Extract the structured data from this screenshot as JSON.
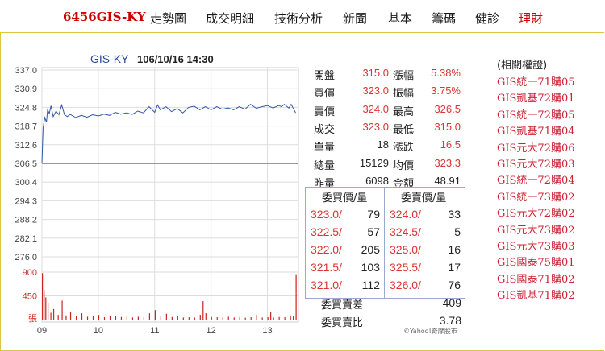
{
  "nav": {
    "stock": "6456GIS-KY",
    "items": [
      "走勢圖",
      "成交明細",
      "技術分析",
      "新聞",
      "基本",
      "籌碼",
      "健診",
      "理財"
    ]
  },
  "chart_header": {
    "symbol": "GIS-KY",
    "datetime": "106/10/16 14:30"
  },
  "chart_data": {
    "type": "line",
    "y_ticks": [
      "337.0",
      "330.9",
      "324.8",
      "318.7",
      "312.6",
      "306.5",
      "300.4",
      "294.3",
      "288.2",
      "282.1",
      "276.0"
    ],
    "ylim": [
      276.0,
      337.0
    ],
    "reference_price": 306.5,
    "x_ticks": [
      "09",
      "10",
      "11",
      "12",
      "13"
    ],
    "volume_ticks": [
      "900",
      "450",
      "張"
    ],
    "volume_max": 900,
    "price_series": [
      [
        9.0,
        306.5
      ],
      [
        9.02,
        318.0
      ],
      [
        9.05,
        321.5
      ],
      [
        9.08,
        320.0
      ],
      [
        9.1,
        324.0
      ],
      [
        9.13,
        322.8
      ],
      [
        9.16,
        325.3
      ],
      [
        9.2,
        321.8
      ],
      [
        9.25,
        323.6
      ],
      [
        9.3,
        322.4
      ],
      [
        9.35,
        325.6
      ],
      [
        9.4,
        322.4
      ],
      [
        9.45,
        321.8
      ],
      [
        9.5,
        322.5
      ],
      [
        9.6,
        321.5
      ],
      [
        9.7,
        322.2
      ],
      [
        9.8,
        321.6
      ],
      [
        9.9,
        322.4
      ],
      [
        10.0,
        322.0
      ],
      [
        10.1,
        322.6
      ],
      [
        10.2,
        322.2
      ],
      [
        10.3,
        323.2
      ],
      [
        10.4,
        322.6
      ],
      [
        10.5,
        323.0
      ],
      [
        10.6,
        322.5
      ],
      [
        10.7,
        323.6
      ],
      [
        10.8,
        323.0
      ],
      [
        10.9,
        325.0
      ],
      [
        11.0,
        323.2
      ],
      [
        11.05,
        325.6
      ],
      [
        11.1,
        324.0
      ],
      [
        11.2,
        325.0
      ],
      [
        11.3,
        323.4
      ],
      [
        11.4,
        324.4
      ],
      [
        11.5,
        323.0
      ],
      [
        11.6,
        324.8
      ],
      [
        11.7,
        325.2
      ],
      [
        11.8,
        324.0
      ],
      [
        11.9,
        325.0
      ],
      [
        12.0,
        324.0
      ],
      [
        12.1,
        325.0
      ],
      [
        12.2,
        324.2
      ],
      [
        12.3,
        324.6
      ],
      [
        12.4,
        324.0
      ],
      [
        12.5,
        325.0
      ],
      [
        12.6,
        324.2
      ],
      [
        12.7,
        325.8
      ],
      [
        12.8,
        324.5
      ],
      [
        12.9,
        325.0
      ],
      [
        13.0,
        325.4
      ],
      [
        13.1,
        324.6
      ],
      [
        13.2,
        325.4
      ],
      [
        13.25,
        325.0
      ],
      [
        13.3,
        325.8
      ],
      [
        13.38,
        324.6
      ],
      [
        13.42,
        325.8
      ],
      [
        13.5,
        323.0
      ]
    ],
    "volume_series": [
      [
        9.0,
        880
      ],
      [
        9.03,
        560
      ],
      [
        9.06,
        420
      ],
      [
        9.1,
        320
      ],
      [
        9.15,
        130
      ],
      [
        9.2,
        200
      ],
      [
        9.28,
        90
      ],
      [
        9.35,
        360
      ],
      [
        9.42,
        80
      ],
      [
        9.5,
        150
      ],
      [
        9.6,
        60
      ],
      [
        9.7,
        120
      ],
      [
        9.8,
        55
      ],
      [
        9.9,
        70
      ],
      [
        10.0,
        90
      ],
      [
        10.1,
        45
      ],
      [
        10.2,
        60
      ],
      [
        10.3,
        70
      ],
      [
        10.4,
        50
      ],
      [
        10.5,
        65
      ],
      [
        10.6,
        40
      ],
      [
        10.7,
        55
      ],
      [
        10.8,
        45
      ],
      [
        10.9,
        120
      ],
      [
        11.0,
        180
      ],
      [
        11.1,
        60
      ],
      [
        11.2,
        110
      ],
      [
        11.3,
        50
      ],
      [
        11.4,
        70
      ],
      [
        11.5,
        40
      ],
      [
        11.6,
        45
      ],
      [
        11.7,
        40
      ],
      [
        11.8,
        90
      ],
      [
        11.85,
        350
      ],
      [
        11.9,
        120
      ],
      [
        12.0,
        50
      ],
      [
        12.1,
        45
      ],
      [
        12.2,
        40
      ],
      [
        12.3,
        55
      ],
      [
        12.4,
        40
      ],
      [
        12.5,
        50
      ],
      [
        12.6,
        35
      ],
      [
        12.7,
        45
      ],
      [
        12.8,
        90
      ],
      [
        12.9,
        40
      ],
      [
        13.0,
        45
      ],
      [
        13.05,
        140
      ],
      [
        13.1,
        40
      ],
      [
        13.2,
        50
      ],
      [
        13.3,
        45
      ],
      [
        13.4,
        80
      ],
      [
        13.45,
        60
      ],
      [
        13.5,
        860
      ]
    ],
    "line_color": "#3355aa",
    "volume_color": "#cc2222",
    "reference_color": "#999999"
  },
  "quote": {
    "rows": [
      {
        "l1": "開盤",
        "v1": "315.0",
        "c1": "red",
        "l2": "漲幅",
        "v2": "5.38%",
        "c2": "red"
      },
      {
        "l1": "買價",
        "v1": "323.0",
        "c1": "red",
        "l2": "振幅",
        "v2": "3.75%",
        "c2": "red"
      },
      {
        "l1": "賣價",
        "v1": "324.0",
        "c1": "red",
        "l2": "最高",
        "v2": "326.5",
        "c2": "red"
      },
      {
        "l1": "成交",
        "v1": "323.0",
        "c1": "red",
        "l2": "最低",
        "v2": "315.0",
        "c2": "red"
      },
      {
        "l1": "單量",
        "v1": "18",
        "c1": "black",
        "l2": "漲跌",
        "v2": "16.5",
        "c2": "red"
      },
      {
        "l1": "總量",
        "v1": "15129",
        "c1": "black",
        "l2": "均價",
        "v2": "323.3",
        "c2": "red"
      },
      {
        "l1": "昨量",
        "v1": "6098",
        "c1": "black",
        "l2": "金額",
        "v2": "48.91",
        "c2": "black"
      }
    ]
  },
  "order_book": {
    "bid_header": "委買價/量",
    "ask_header": "委賣價/量",
    "bids": [
      {
        "price": "323.0/",
        "qty": "79"
      },
      {
        "price": "322.5/",
        "qty": "57"
      },
      {
        "price": "322.0/",
        "qty": "205"
      },
      {
        "price": "321.5/",
        "qty": "103"
      },
      {
        "price": "321.0/",
        "qty": "112"
      }
    ],
    "asks": [
      {
        "price": "324.0/",
        "qty": "33"
      },
      {
        "price": "324.5/",
        "qty": "5"
      },
      {
        "price": "325.0/",
        "qty": "16"
      },
      {
        "price": "325.5/",
        "qty": "17"
      },
      {
        "price": "326.0/",
        "qty": "76"
      }
    ],
    "diff_label": "委買賣差",
    "diff_value": "409",
    "ratio_label": "委買賣比",
    "ratio_value": "3.78",
    "credit": "©Yahoo!奇摩股市"
  },
  "warrants": {
    "title": "(相關權證)",
    "items": [
      "GIS統一71購05",
      "GIS凱基72購01",
      "GIS統一72購05",
      "GIS凱基71購04",
      "GIS元大72購06",
      "GIS元大72購03",
      "GIS統一72購04",
      "GIS統一73購02",
      "GIS元大72購02",
      "GIS元大73購02",
      "GIS元大73購03",
      "GIS國泰75購01",
      "GIS國泰71購02",
      "GIS凱基71購02"
    ]
  }
}
